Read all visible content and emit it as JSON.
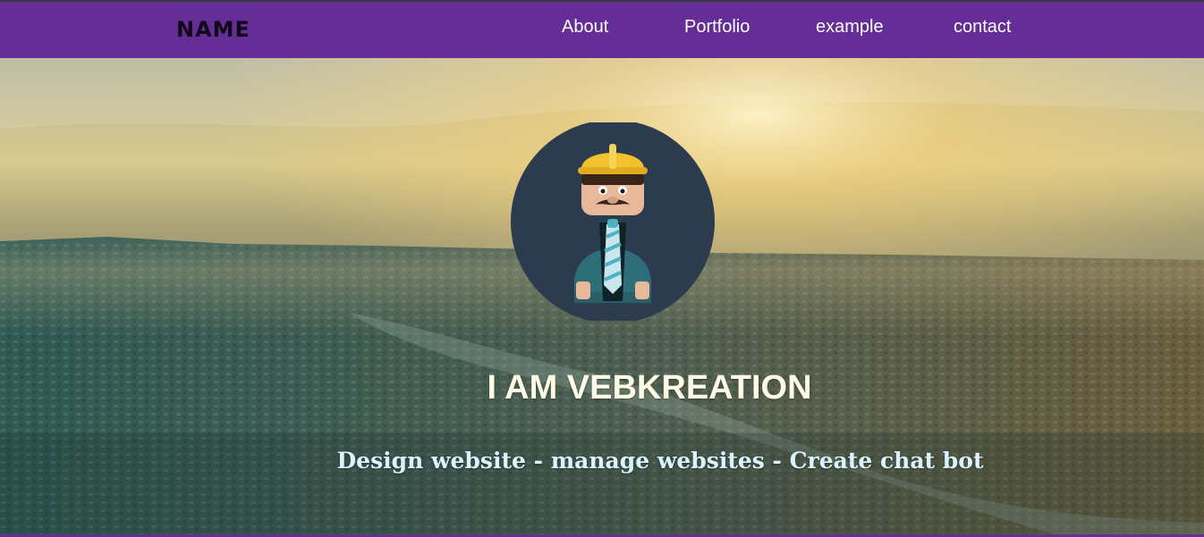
{
  "navbar": {
    "brand": "NAME",
    "links": [
      {
        "label": "About"
      },
      {
        "label": "Portfolio"
      },
      {
        "label": "example"
      },
      {
        "label": "contact"
      }
    ],
    "background_color": "#652d96"
  },
  "hero": {
    "headline": "I AM VEBKREATION",
    "tagline": "Design website - manage websites - Create chat bot",
    "avatar": {
      "icon": "construction-worker-icon",
      "circle_color": "#2d3b4e",
      "helmet_color": "#f2c12e"
    }
  }
}
